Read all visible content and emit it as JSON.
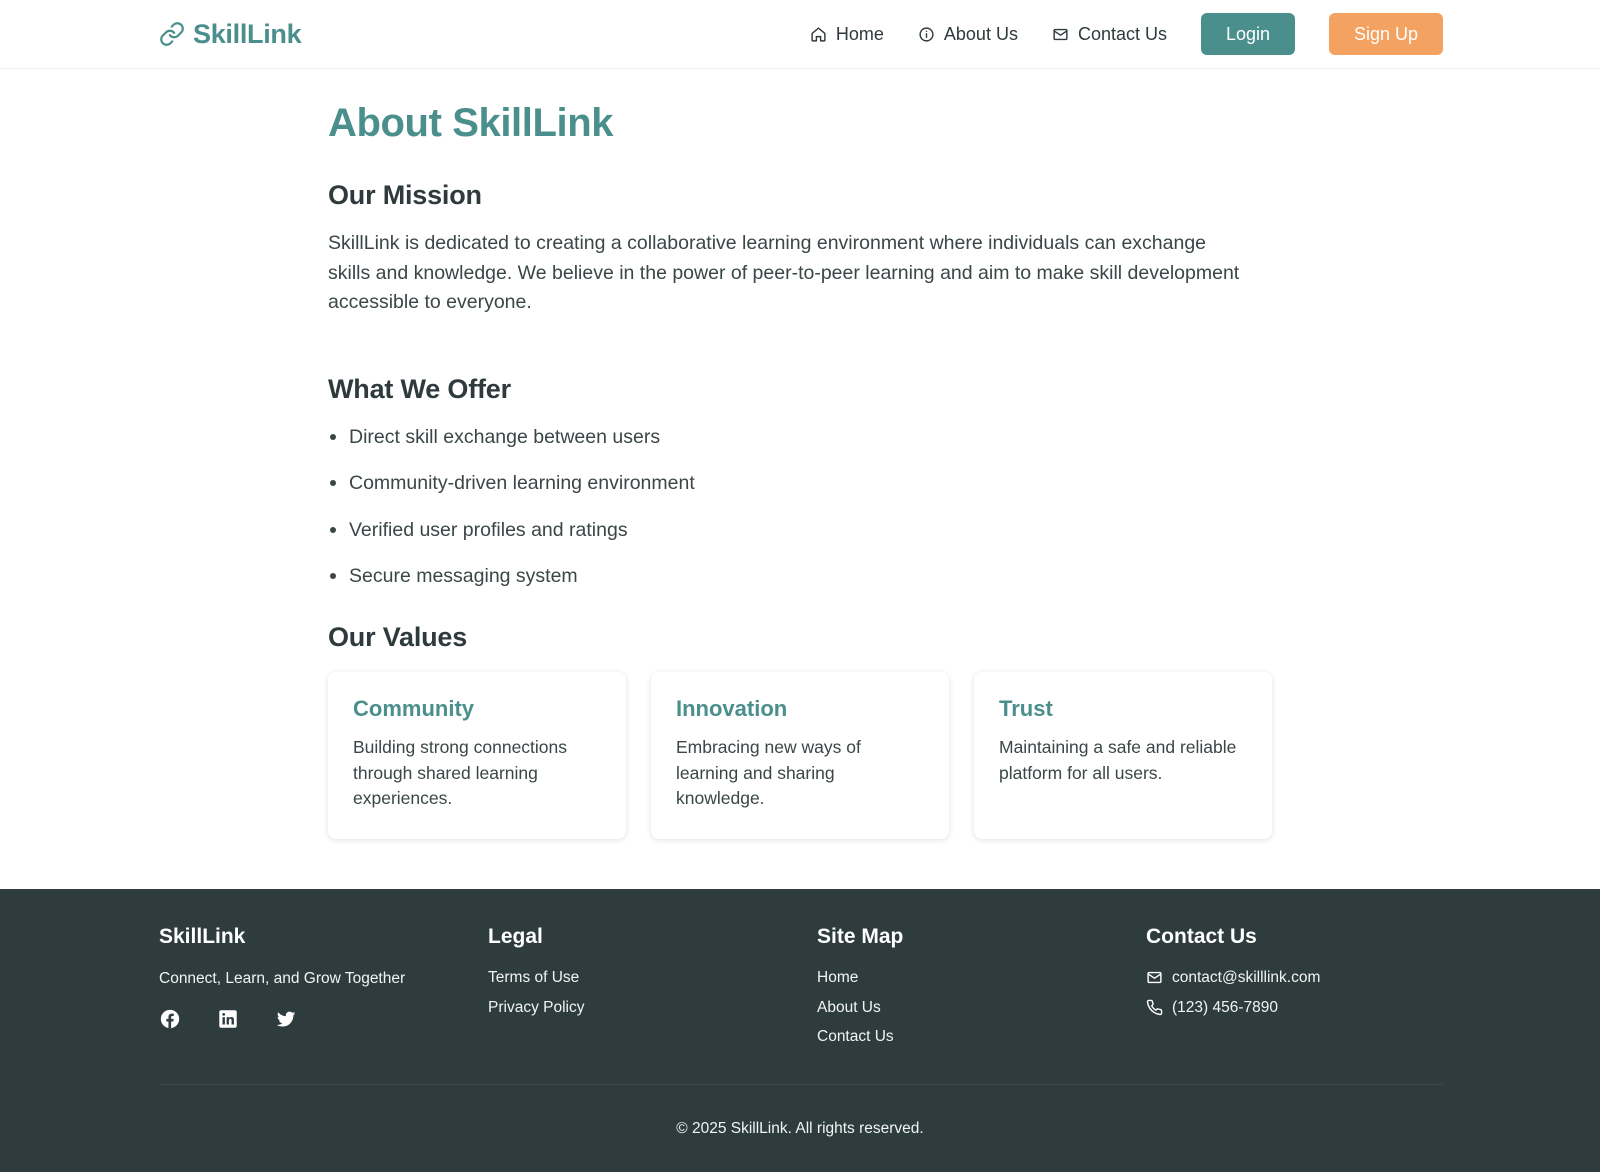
{
  "header": {
    "brand": "SkillLink",
    "nav": [
      {
        "label": "Home",
        "icon": "home-icon"
      },
      {
        "label": "About Us",
        "icon": "info-icon"
      },
      {
        "label": "Contact Us",
        "icon": "mail-icon"
      }
    ],
    "login_label": "Login",
    "signup_label": "Sign Up"
  },
  "main": {
    "title": "About SkillLink",
    "mission": {
      "heading": "Our Mission",
      "text": "SkillLink is dedicated to creating a collaborative learning environment where individuals can exchange skills and knowledge. We believe in the power of peer-to-peer learning and aim to make skill development accessible to everyone."
    },
    "offer": {
      "heading": "What We Offer",
      "items": [
        "Direct skill exchange between users",
        "Community-driven learning environment",
        "Verified user profiles and ratings",
        "Secure messaging system"
      ]
    },
    "values": {
      "heading": "Our Values",
      "cards": [
        {
          "title": "Community",
          "text": "Building strong connections through shared learning experiences."
        },
        {
          "title": "Innovation",
          "text": "Embracing new ways of learning and sharing knowledge."
        },
        {
          "title": "Trust",
          "text": "Maintaining a safe and reliable platform for all users."
        }
      ]
    }
  },
  "footer": {
    "brand": {
      "title": "SkillLink",
      "tagline": "Connect, Learn, and Grow Together"
    },
    "socials": [
      "facebook-icon",
      "linkedin-icon",
      "twitter-icon"
    ],
    "legal": {
      "title": "Legal",
      "links": [
        "Terms of Use",
        "Privacy Policy"
      ]
    },
    "sitemap": {
      "title": "Site Map",
      "links": [
        "Home",
        "About Us",
        "Contact Us"
      ]
    },
    "contact": {
      "title": "Contact Us",
      "email": "contact@skilllink.com",
      "phone": "(123) 456-7890"
    },
    "copyright": "© 2025 SkillLink. All rights reserved."
  },
  "colors": {
    "primary": "#4a8f8c",
    "accent": "#f4a261",
    "footer_bg": "#2e3c3d",
    "text": "#2e3a3b"
  }
}
